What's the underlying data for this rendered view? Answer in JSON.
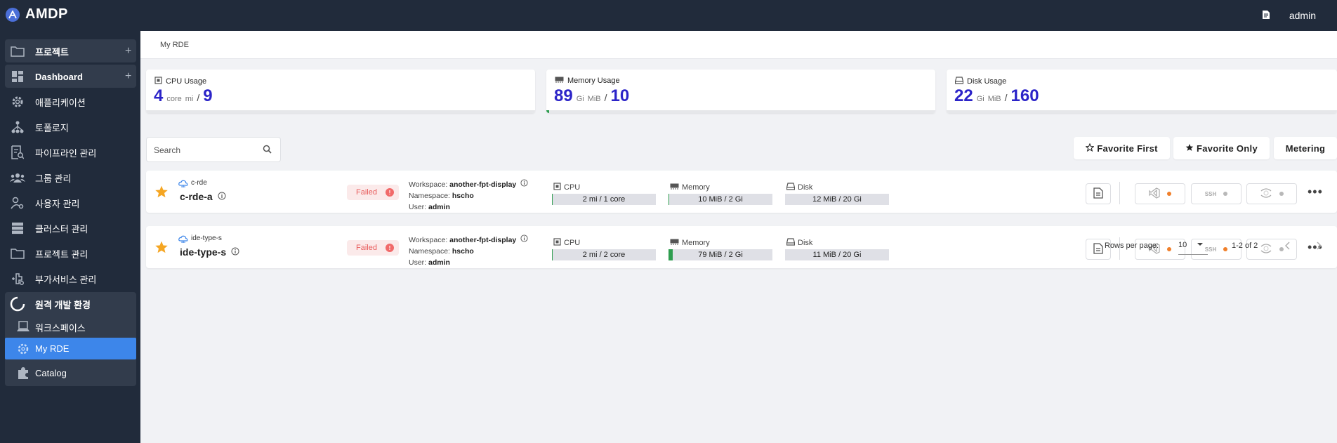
{
  "app": {
    "name": "AMDP",
    "user": "admin"
  },
  "sidebar": {
    "items": [
      {
        "label": "프로젝트",
        "plus": "+"
      },
      {
        "label": "Dashboard",
        "plus": "+"
      },
      {
        "label": "애플리케이션"
      },
      {
        "label": "토폴로지"
      },
      {
        "label": "파이프라인 관리"
      },
      {
        "label": "그룹 관리"
      },
      {
        "label": "사용자 관리"
      },
      {
        "label": "클러스터 관리"
      },
      {
        "label": "프로젝트 관리"
      },
      {
        "label": "부가서비스 관리"
      },
      {
        "label": "원격 개발 환경"
      },
      {
        "label": "워크스페이스"
      },
      {
        "label": "My RDE"
      },
      {
        "label": "Catalog"
      }
    ]
  },
  "breadcrumb": "My RDE",
  "usage": {
    "cpu": {
      "title": "CPU Usage",
      "value": "4",
      "unit1": "core",
      "unit2": "mi",
      "slash": "/",
      "total": "9",
      "fill": 0
    },
    "memory": {
      "title": "Memory Usage",
      "value": "89",
      "unit1": "Gi",
      "unit2": "MiB",
      "slash": "/",
      "total": "10",
      "fill": 0.008
    },
    "disk": {
      "title": "Disk Usage",
      "value": "22",
      "unit1": "Gi",
      "unit2": "MiB",
      "slash": "/",
      "total": "160",
      "fill": 0
    }
  },
  "search": {
    "placeholder": "Search"
  },
  "toolbar": {
    "favorite_first": "Favorite First",
    "favorite_only": "Favorite Only",
    "metering": "Metering"
  },
  "rows": [
    {
      "kind": "c-rde",
      "name": "c-rde-a",
      "status": "Failed",
      "workspace_label": "Workspace:",
      "workspace": "another-fpt-display",
      "namespace_label": "Namespace:",
      "namespace": "hscho",
      "user_label": "User:",
      "user": "admin",
      "cpu_label": "CPU",
      "cpu": "2 mi / 1 core",
      "cpu_fill": 0.005,
      "memory_label": "Memory",
      "memory": "10 MiB / 2 Gi",
      "memory_fill": 0.005,
      "disk_label": "Disk",
      "disk": "12 MiB / 20 Gi",
      "disk_fill": 0.0,
      "vscode_status_color": "#f07f2a",
      "ssh_status_color": "#b8b8b8",
      "jupyter_status_color": "#b8b8b8",
      "ssh_text": "SSH"
    },
    {
      "kind": "ide-type-s",
      "name": "ide-type-s",
      "status": "Failed",
      "workspace_label": "Workspace:",
      "workspace": "another-fpt-display",
      "namespace_label": "Namespace:",
      "namespace": "hscho",
      "user_label": "User:",
      "user": "admin",
      "cpu_label": "CPU",
      "cpu": "2 mi / 2 core",
      "cpu_fill": 0.005,
      "memory_label": "Memory",
      "memory": "79 MiB / 2 Gi",
      "memory_fill": 0.04,
      "disk_label": "Disk",
      "disk": "11 MiB / 20 Gi",
      "disk_fill": 0.0,
      "vscode_status_color": "#f07f2a",
      "ssh_status_color": "#f07f2a",
      "jupyter_status_color": "#b8b8b8",
      "ssh_text": "SSH"
    }
  ],
  "pagination": {
    "rows_per_page_label": "Rows per page:",
    "rows_per_page": "10",
    "range": "1-2 of 2"
  },
  "colors": {
    "sidebar_bg": "#212b3b",
    "active": "#3d86ea",
    "value": "#2c24c8",
    "failed": "#e85b5b",
    "fill": "#2e9d4f"
  }
}
